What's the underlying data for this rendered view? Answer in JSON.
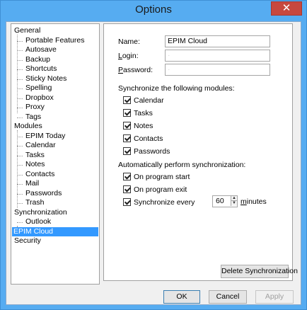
{
  "window": {
    "title": "Options",
    "close_glyph": "✕"
  },
  "tree": {
    "items": [
      {
        "label": "General",
        "level": 0,
        "selected": false
      },
      {
        "label": "Portable Features",
        "level": 1,
        "selected": false
      },
      {
        "label": "Autosave",
        "level": 1,
        "selected": false
      },
      {
        "label": "Backup",
        "level": 1,
        "selected": false
      },
      {
        "label": "Shortcuts",
        "level": 1,
        "selected": false
      },
      {
        "label": "Sticky Notes",
        "level": 1,
        "selected": false
      },
      {
        "label": "Spelling",
        "level": 1,
        "selected": false
      },
      {
        "label": "Dropbox",
        "level": 1,
        "selected": false
      },
      {
        "label": "Proxy",
        "level": 1,
        "selected": false
      },
      {
        "label": "Tags",
        "level": 1,
        "selected": false
      },
      {
        "label": "Modules",
        "level": 0,
        "selected": false
      },
      {
        "label": "EPIM Today",
        "level": 1,
        "selected": false
      },
      {
        "label": "Calendar",
        "level": 1,
        "selected": false
      },
      {
        "label": "Tasks",
        "level": 1,
        "selected": false
      },
      {
        "label": "Notes",
        "level": 1,
        "selected": false
      },
      {
        "label": "Contacts",
        "level": 1,
        "selected": false
      },
      {
        "label": "Mail",
        "level": 1,
        "selected": false
      },
      {
        "label": "Passwords",
        "level": 1,
        "selected": false
      },
      {
        "label": "Trash",
        "level": 1,
        "selected": false
      },
      {
        "label": "Synchronization",
        "level": 0,
        "selected": false
      },
      {
        "label": "Outlook",
        "level": 1,
        "selected": false
      },
      {
        "label": "EPIM Cloud",
        "level": 0,
        "selected": true
      },
      {
        "label": "Security",
        "level": 0,
        "selected": false
      }
    ]
  },
  "form": {
    "name_label": "Name:",
    "name_value": "EPIM Cloud",
    "login_label_ul": "L",
    "login_label_rest": "ogin:",
    "login_value": "·",
    "password_label_ul": "P",
    "password_label_rest": "assword:",
    "password_value": "·",
    "modules_heading": "Synchronize the following modules:",
    "modules": {
      "calendar": {
        "label": "Calendar",
        "checked": true
      },
      "tasks": {
        "label": "Tasks",
        "checked": true
      },
      "notes": {
        "label": "Notes",
        "checked": true
      },
      "contacts": {
        "label": "Contacts",
        "checked": true
      },
      "passwords": {
        "label": "Passwords",
        "checked": true
      }
    },
    "auto_heading": "Automatically perform synchronization:",
    "auto": {
      "start": {
        "label": "On program start",
        "checked": true
      },
      "exit": {
        "label": "On program exit",
        "checked": true
      },
      "every": {
        "label": "Synchronize every",
        "checked": true
      }
    },
    "interval_value": "60",
    "minutes_ul": "m",
    "minutes_rest": "inutes",
    "delete_button": "Delete Synchronization"
  },
  "footer": {
    "ok": "OK",
    "cancel": "Cancel",
    "apply": "Apply"
  },
  "colors": {
    "title_bar": "#56acf1",
    "close_button": "#c7483e",
    "selection": "#3399ff"
  }
}
